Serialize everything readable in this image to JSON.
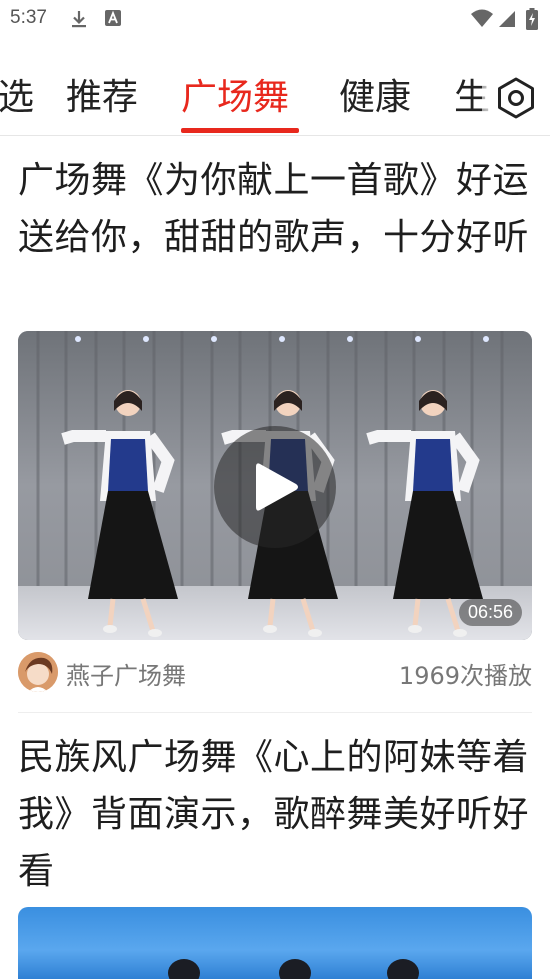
{
  "status_bar": {
    "time": "5:37",
    "icons": [
      "download-icon",
      "a-notification-icon",
      "wifi-icon",
      "cell-signal-icon",
      "battery-charging-icon"
    ]
  },
  "tabs": {
    "items": [
      {
        "label": "选"
      },
      {
        "label": "推荐"
      },
      {
        "label": "广场舞",
        "active": true
      },
      {
        "label": "健康"
      },
      {
        "label": "生"
      }
    ],
    "settings_icon": "settings-icon",
    "accent_color": "#e8281d"
  },
  "feed": [
    {
      "title": "广场舞《为你献上一首歌》好运送给你，甜甜的歌声，十分好听",
      "duration": "06:56",
      "author": "燕子广场舞",
      "plays": "1969次播放"
    },
    {
      "title": "民族风广场舞《心上的阿妹等着我》背面演示，歌醉舞美好听好看"
    }
  ]
}
